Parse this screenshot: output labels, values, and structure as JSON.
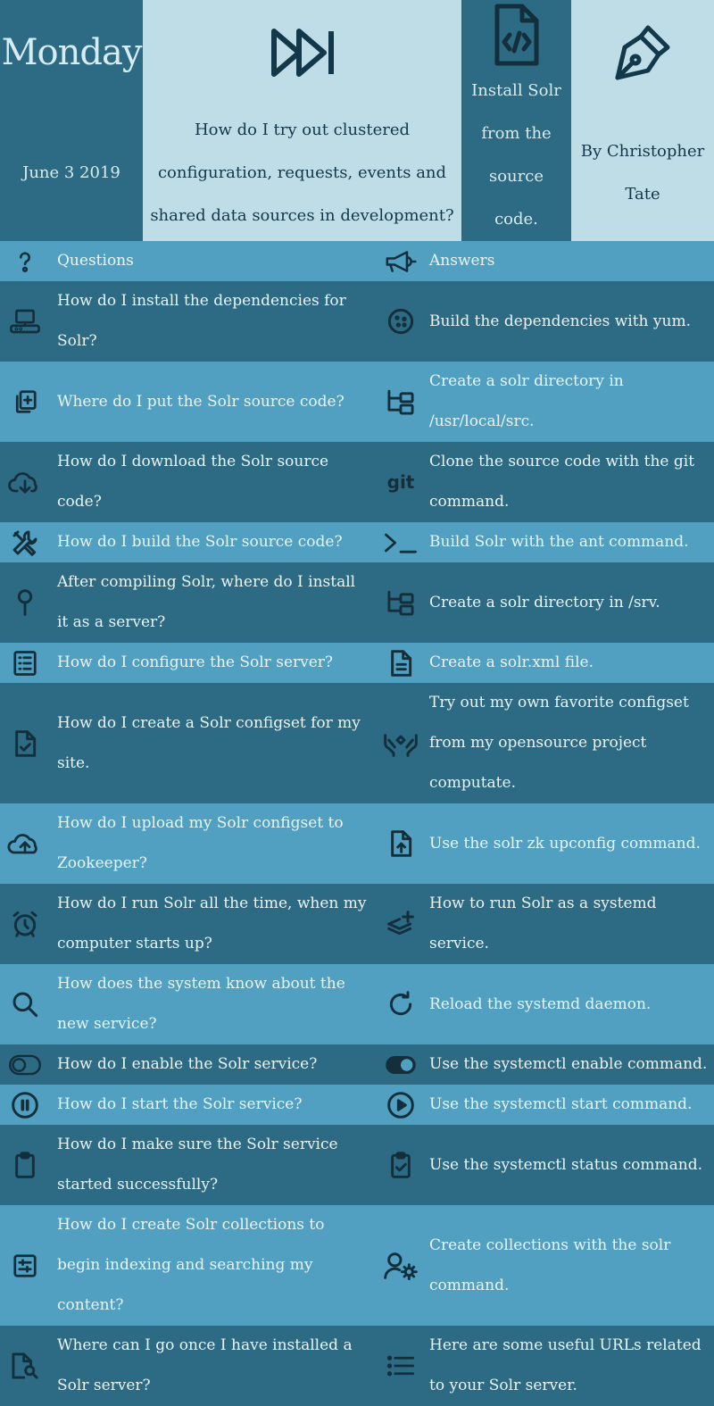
{
  "header": {
    "day": "Monday",
    "date": "June 3 2019",
    "question": "How do I try out clustered configuration, requests, events and shared data sources in development?",
    "goal": "Install Solr from the source code.",
    "author": "By Christopher Tate",
    "icons": [
      "fast-forward-icon",
      "code-file-icon",
      "pen-nib-icon"
    ]
  },
  "colors": {
    "dark": "#2d6a84",
    "light": "#51a0c1",
    "header_light": "#bfdde7",
    "icon": "#132f3c"
  },
  "rows": [
    {
      "q": "Questions",
      "a": "Answers",
      "q_icon": "question-icon",
      "a_icon": "megaphone-icon"
    },
    {
      "q": "How do I install the dependencies for Solr?",
      "a": "Build the dependencies with yum.",
      "q_icon": "computer-icon",
      "a_icon": "cookie-icon"
    },
    {
      "q": "Where do I put the Solr source code?",
      "a": "Create a solr directory in /usr/local/src.",
      "q_icon": "copy-plus-icon",
      "a_icon": "folder-tree-icon"
    },
    {
      "q": "How do I download the Solr source code?",
      "a": "Clone the source code with the git command.",
      "q_icon": "cloud-download-icon",
      "a_icon": "git-icon",
      "a_label": "git"
    },
    {
      "q": "How do I build the Solr source code?",
      "a": "Build Solr with the ant command.",
      "q_icon": "tools-icon",
      "a_icon": "terminal-icon"
    },
    {
      "q": "After compiling Solr, where do I install it as a server?",
      "a": "Create a solr directory in /srv.",
      "q_icon": "map-pin-icon",
      "a_icon": "folder-tree-icon"
    },
    {
      "q": "How do I configure the Solr server?",
      "a": "Create a solr.xml file.",
      "q_icon": "list-doc-icon",
      "a_icon": "file-text-icon"
    },
    {
      "q": "How do I create a Solr configset for my site.",
      "a": "Try out my own favorite configset from my opensource project computate.",
      "q_icon": "file-check-icon",
      "a_icon": "hands-icon"
    },
    {
      "q": "How do I upload my Solr configset to Zookeeper?",
      "a": "Use the solr zk upconfig command.",
      "q_icon": "cloud-upload-icon",
      "a_icon": "file-upload-icon"
    },
    {
      "q": "How do I run Solr all the time, when my computer starts up?",
      "a": "How to run Solr as a systemd service.",
      "q_icon": "alarm-clock-icon",
      "a_icon": "layers-plus-icon"
    },
    {
      "q": "How does the system know about the new service?",
      "a": "Reload the systemd daemon.",
      "q_icon": "search-icon",
      "a_icon": "reload-icon"
    },
    {
      "q": "How do I enable the Solr service?",
      "a": "Use the systemctl enable command.",
      "q_icon": "toggle-off-icon",
      "a_icon": "toggle-on-icon"
    },
    {
      "q": "How do I start the Solr service?",
      "a": "Use the systemctl start command.",
      "q_icon": "pause-circle-icon",
      "a_icon": "play-circle-icon"
    },
    {
      "q": "How do I make sure the Solr service started successfully?",
      "a": "Use the systemctl status command.",
      "q_icon": "clipboard-icon",
      "a_icon": "clipboard-check-icon"
    },
    {
      "q": "How do I create Solr collections to begin indexing and searching my content?",
      "a": "Create collections with the solr command.",
      "q_icon": "sliders-icon",
      "a_icon": "user-settings-icon"
    },
    {
      "q": "Where can I go once I have installed a Solr server?",
      "a": "Here are some useful URLs related to your Solr server.",
      "q_icon": "file-search-icon",
      "a_icon": "list-icon"
    }
  ]
}
